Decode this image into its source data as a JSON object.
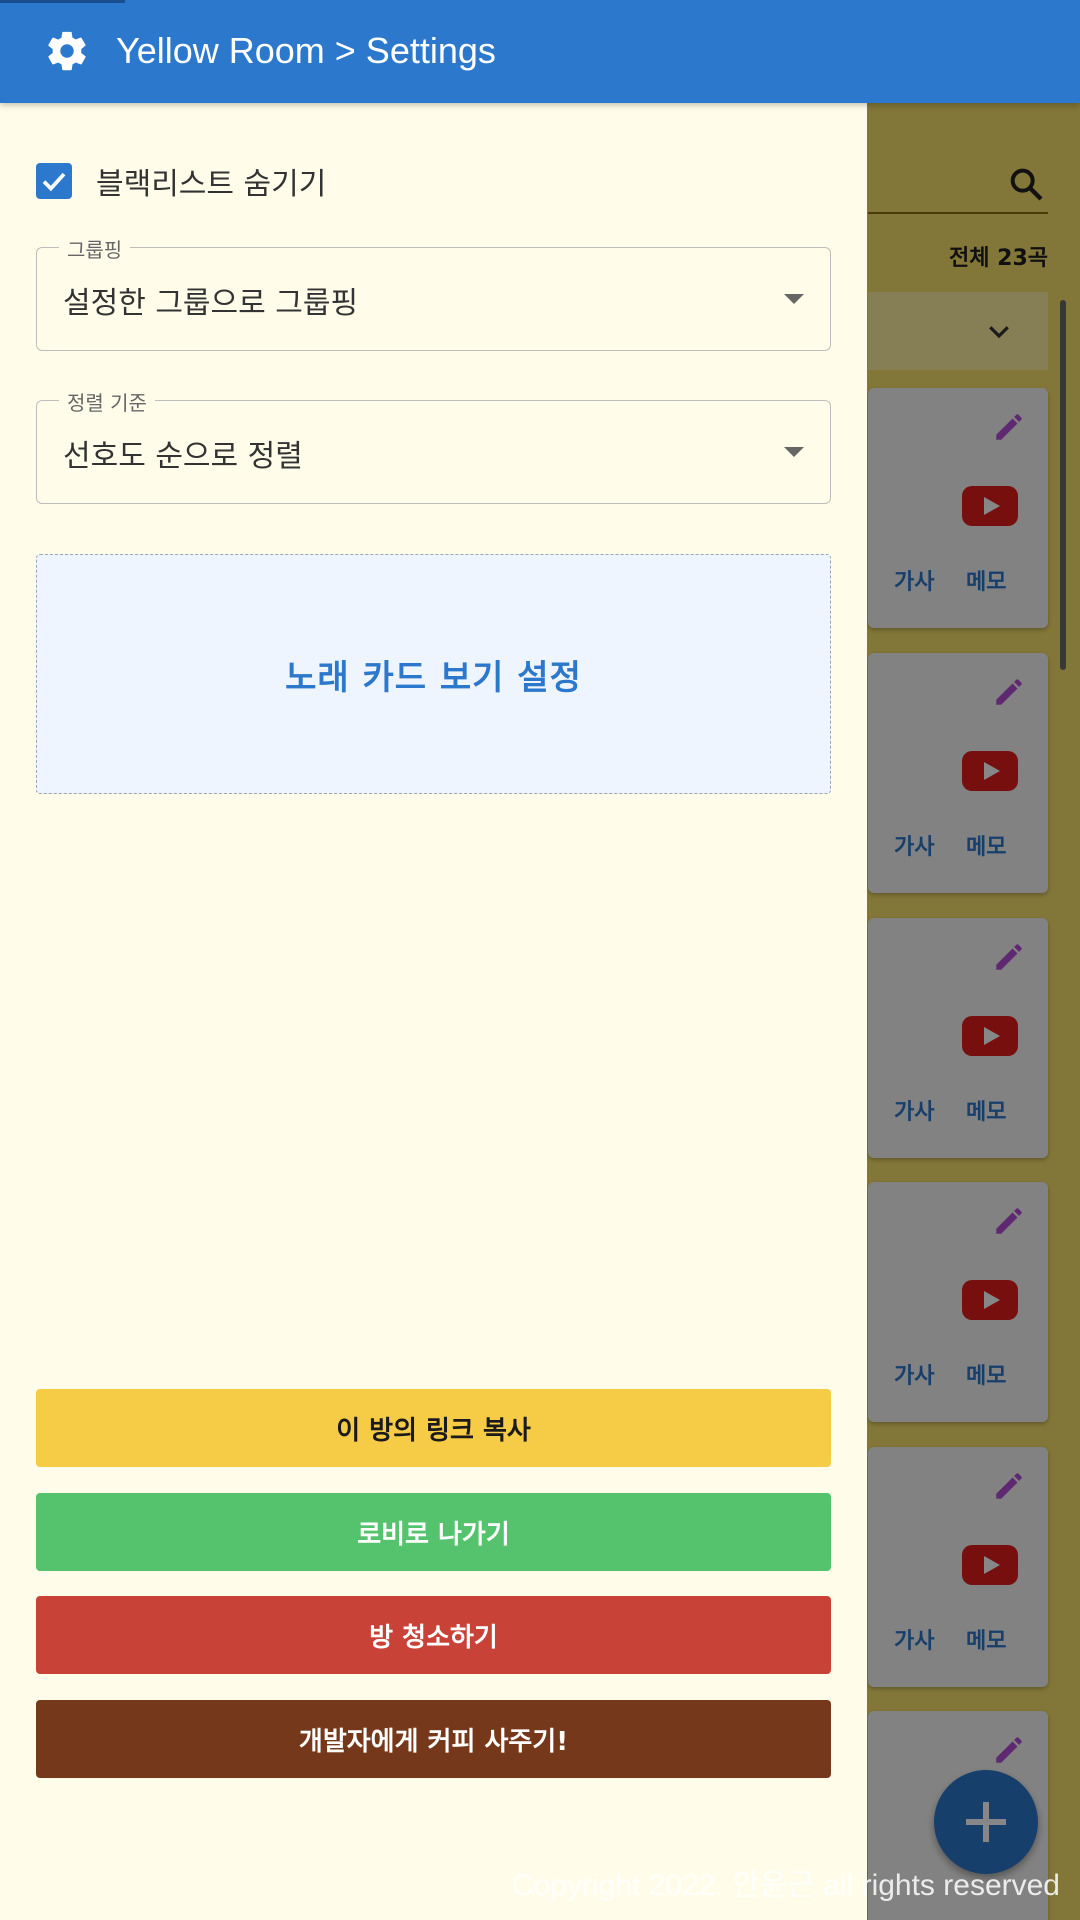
{
  "appbar": {
    "title": "Yellow Room > Settings",
    "icon": "gear-icon",
    "color": "#2c78cc"
  },
  "background": {
    "total_label": "전체 23곡",
    "cards": [
      {
        "lyric": "가사",
        "memo": "메모"
      },
      {
        "lyric": "가사",
        "memo": "메모"
      },
      {
        "lyric": "가사",
        "memo": "메모"
      },
      {
        "lyric": "가사",
        "memo": "메모"
      },
      {
        "lyric": "가사",
        "memo": "메모"
      }
    ],
    "copyright": "Copyright 2022. 안윤근 all rights reserved"
  },
  "drawer": {
    "hide_blacklist": {
      "label": "블랙리스트 숨기기",
      "checked": true
    },
    "grouping": {
      "legend": "그룹핑",
      "value": "설정한 그룹으로 그룹핑"
    },
    "sorting": {
      "legend": "정렬 기준",
      "value": "선호도 순으로 정렬"
    },
    "card_view_settings": "노래 카드 보기 설정",
    "buttons": {
      "copy_link": "이 방의 링크 복사",
      "to_lobby": "로비로 나가기",
      "clean_room": "방 청소하기",
      "buy_coffee": "개발자에게 커피 사주기!"
    }
  },
  "colors": {
    "yellow_button": "#f6cb45",
    "green_button": "#55c36d",
    "red_button": "#c94238",
    "brown_button": "#76381a",
    "accent": "#2c78cc"
  }
}
